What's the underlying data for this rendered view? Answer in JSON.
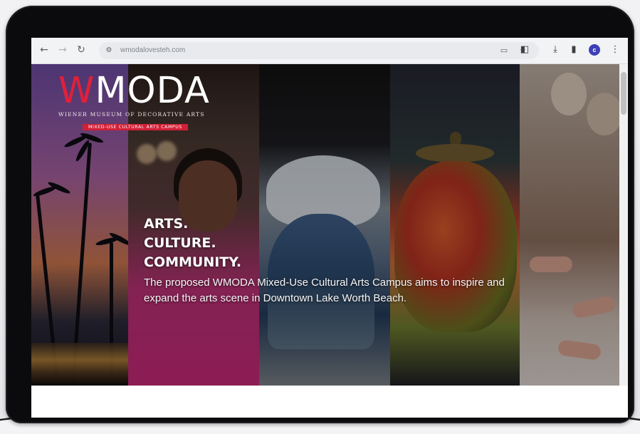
{
  "browser": {
    "url": "wmodalovesteh.com",
    "icons": {
      "back": "arrow-left-icon",
      "forward": "arrow-right-icon",
      "reload": "reload-icon",
      "site_info": "site-settings-icon",
      "cast": "cast-icon",
      "bookmark": "star-icon",
      "extensions": "puzzle-icon",
      "download": "download-icon",
      "side_panel": "side-panel-icon",
      "menu": "kebab-menu-icon"
    },
    "profile_initial": "c"
  },
  "hero": {
    "logo": {
      "word_w": "W",
      "word_rest": "MODA",
      "subtitle": "WIENER MUSEUM OF DECORATIVE ARTS",
      "banner": "MIXED-USE CULTURAL ARTS CAMPUS"
    },
    "headline_lines": [
      "ARTS.",
      "CULTURE.",
      "COMMUNITY."
    ],
    "tagline": "The proposed WMODA Mixed-Use Cultural Arts Campus aims to inspire and expand the arts scene in Downtown Lake Worth Beach."
  },
  "colors": {
    "accent_red": "#d21f36",
    "profile_blue": "#3d3fb8"
  }
}
